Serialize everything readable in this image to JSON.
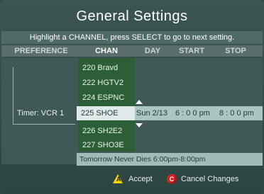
{
  "title": "General Settings",
  "instruction": "Highlight a CHANNEL, press SELECT to go to next setting.",
  "headers": {
    "preference": "PREFERENCE",
    "chan": "CHAN",
    "day": "DAY",
    "start": "START",
    "stop": "STOP"
  },
  "channels": [
    {
      "label": "220 Bravd"
    },
    {
      "label": "222 HGTV2"
    },
    {
      "label": "224 ESPNC"
    },
    {
      "label": "225 SHOE"
    },
    {
      "label": "226 SH2E2"
    },
    {
      "label": "227 SHO3E"
    }
  ],
  "selected_row": {
    "preference": "Timer: VCR 1",
    "channel": "225 SHOE",
    "day": "Sun 2/13",
    "start": "6 : 0 0 pm",
    "stop": "8 : 0 0 pm"
  },
  "program_info": "Tomorrow Never Dies  6:00pm-8:00pm",
  "footer": {
    "accept_label": "Accept",
    "accept_key": "A",
    "cancel_label": "Cancel Changes",
    "cancel_key": "C"
  },
  "colors": {
    "accent_channel": "#2c5e37",
    "highlight": "#a9c6c2",
    "accept_yellow": "#f0d400",
    "cancel_red": "#d82020"
  }
}
